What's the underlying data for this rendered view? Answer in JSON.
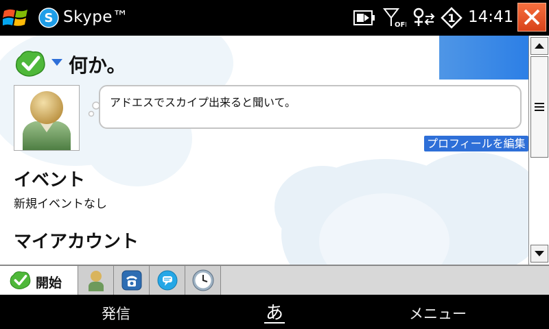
{
  "titlebar": {
    "app_title": "Skype™",
    "clock": "14:41"
  },
  "profile": {
    "mood_title": "何か。",
    "mood_message": "アドエスでスカイプ出来ると聞いて。",
    "edit_profile_label": "プロフィールを編集"
  },
  "events": {
    "title": "イベント",
    "none_text": "新規イベントなし"
  },
  "account": {
    "title": "マイアカウント"
  },
  "tabs": {
    "start_label": "開始",
    "icons": [
      "contacts-icon",
      "phone-icon",
      "chat-icon",
      "clock-icon"
    ]
  },
  "softkeys": {
    "left": "発信",
    "ime": "あ",
    "right": "メニュー"
  },
  "colors": {
    "status_online": "#4fb83a",
    "skype_blue": "#1f9ee8",
    "accent_blue": "#2e6fd8",
    "close_orange": "#e8552a"
  }
}
